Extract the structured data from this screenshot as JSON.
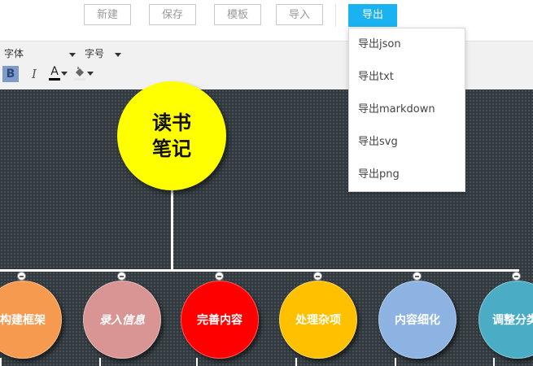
{
  "toolbar": {
    "buttons": [
      "新建",
      "保存",
      "模板",
      "导入",
      "导出"
    ]
  },
  "format": {
    "font_label": "字体",
    "size_label": "字号",
    "bold": "B",
    "italic": "I",
    "font_color": "A"
  },
  "export_menu": [
    "导出json",
    "导出txt",
    "导出markdown",
    "导出svg",
    "导出png"
  ],
  "mindmap": {
    "root": "读书笔记",
    "children": [
      {
        "label": "构建框架",
        "color": "#f59a4e"
      },
      {
        "label": "录入信息",
        "color": "#d99594"
      },
      {
        "label": "完善内容",
        "color": "#ff0000"
      },
      {
        "label": "处理杂项",
        "color": "#ffc000"
      },
      {
        "label": "内容细化",
        "color": "#8db3e2"
      },
      {
        "label": "调整分类",
        "color": "#4bacc6"
      }
    ]
  },
  "colors": {
    "accent": "#1ab2f0",
    "root": "#ffff00",
    "canvas": "#323a3f"
  }
}
